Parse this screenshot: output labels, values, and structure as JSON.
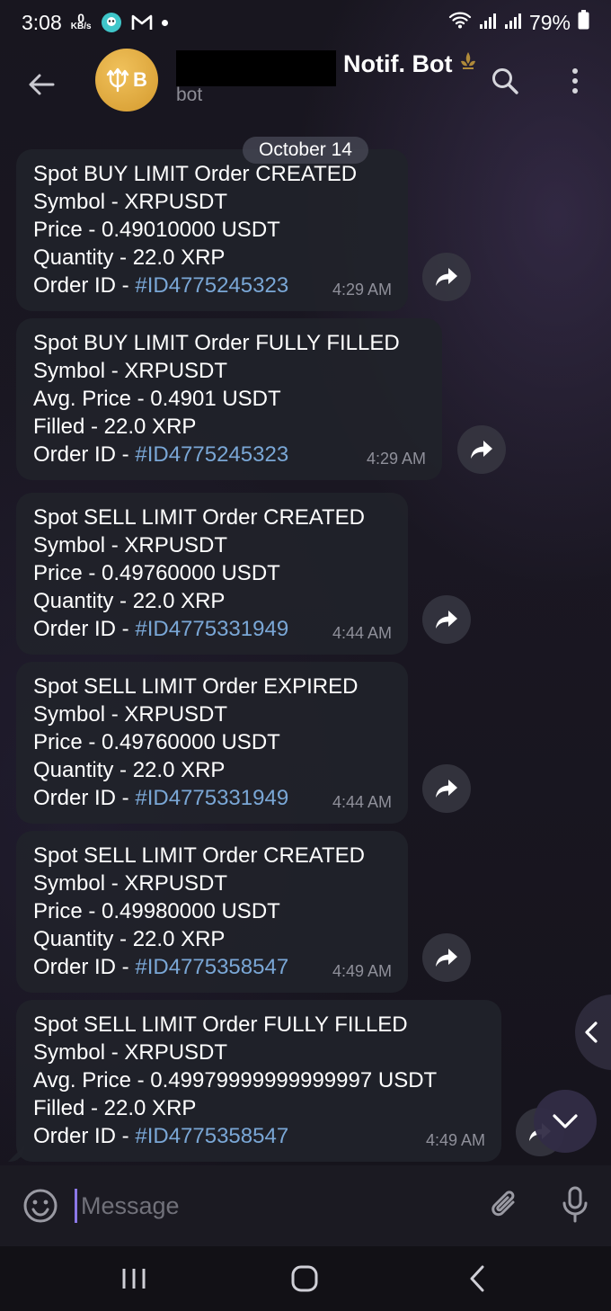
{
  "status_bar": {
    "time": "3:08",
    "net_speed_value": "0",
    "net_speed_unit": "KB/s",
    "battery": "79%"
  },
  "header": {
    "title": "Notif. Bot",
    "subtitle": "bot",
    "avatar_letter": "B"
  },
  "date_label": "October 14",
  "messages": [
    {
      "lines": [
        "Spot BUY LIMIT Order CREATED",
        "Symbol - XRPUSDT",
        "Price - 0.49010000 USDT",
        "Quantity - 22.0 XRP"
      ],
      "order_prefix": "Order ID - ",
      "order_id": "#ID4775245323",
      "time": "4:29 AM"
    },
    {
      "lines": [
        "Spot BUY LIMIT Order FULLY FILLED",
        "Symbol - XRPUSDT",
        "Avg. Price - 0.4901 USDT",
        "Filled - 22.0 XRP"
      ],
      "order_prefix": "Order ID - ",
      "order_id": "#ID4775245323",
      "time": "4:29 AM"
    },
    {
      "lines": [
        "Spot SELL LIMIT Order CREATED",
        "Symbol - XRPUSDT",
        "Price - 0.49760000 USDT",
        "Quantity - 22.0 XRP"
      ],
      "order_prefix": "Order ID - ",
      "order_id": "#ID4775331949",
      "time": "4:44 AM"
    },
    {
      "lines": [
        "Spot SELL LIMIT Order EXPIRED",
        "Symbol - XRPUSDT",
        "Price - 0.49760000 USDT",
        "Quantity - 22.0 XRP"
      ],
      "order_prefix": "Order ID - ",
      "order_id": "#ID4775331949",
      "time": "4:44 AM"
    },
    {
      "lines": [
        "Spot SELL LIMIT Order CREATED",
        "Symbol - XRPUSDT",
        "Price - 0.49980000 USDT",
        "Quantity - 22.0 XRP"
      ],
      "order_prefix": "Order ID - ",
      "order_id": "#ID4775358547",
      "time": "4:49 AM"
    },
    {
      "lines": [
        "Spot SELL LIMIT Order FULLY FILLED",
        "Symbol - XRPUSDT",
        "Avg. Price - 0.49979999999999997 USDT",
        "Filled - 22.0 XRP"
      ],
      "order_prefix": "Order ID - ",
      "order_id": "#ID4775358547",
      "time": "4:49 AM"
    }
  ],
  "composer": {
    "placeholder": "Message"
  },
  "colors": {
    "link": "#7aa7d6",
    "bubble": "#20222a",
    "avatar": "#e0ab42",
    "caret": "#8c78e8"
  },
  "icons": {
    "back": "arrow-left-icon",
    "search": "search-icon",
    "menu": "more-vertical-icon",
    "share": "share-arrow-icon",
    "emoji": "emoji-icon",
    "attach": "paperclip-icon",
    "mic": "microphone-icon"
  }
}
